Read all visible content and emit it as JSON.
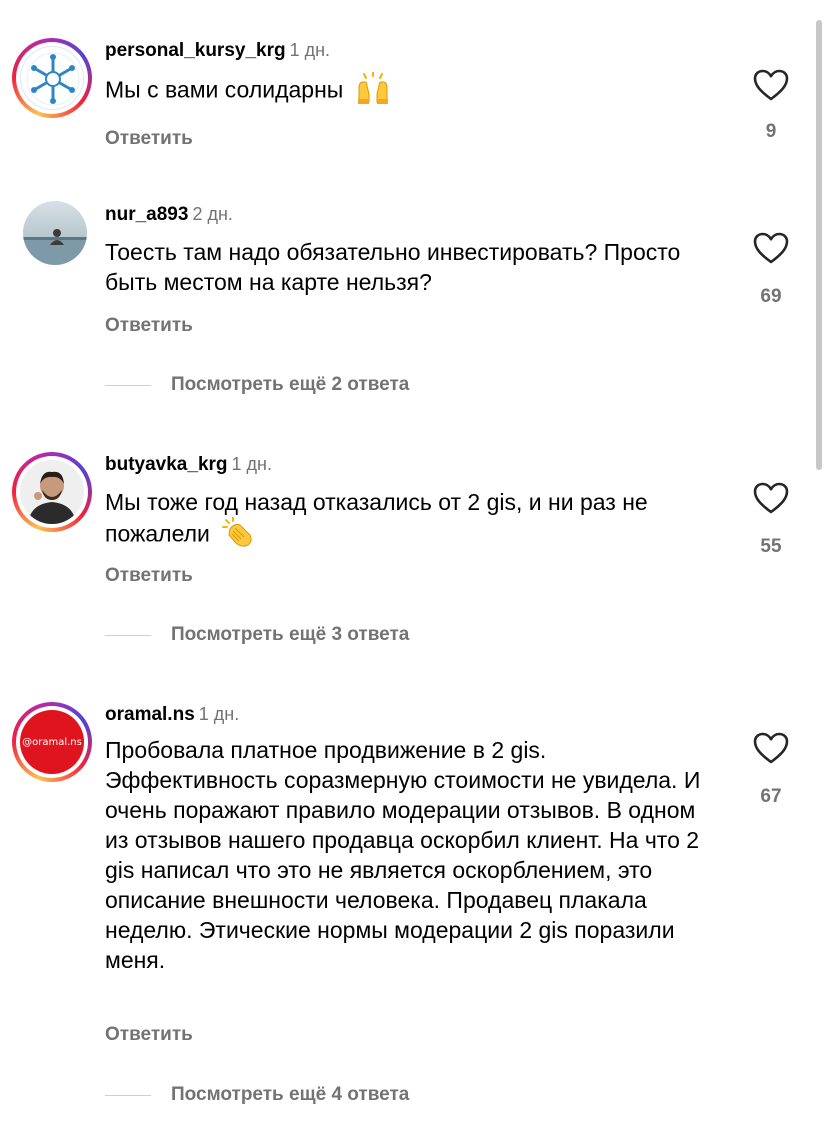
{
  "comments": [
    {
      "username": "personal_kursy_krg",
      "time": "1 дн.",
      "text": "Мы с вами солидарны",
      "emoji": "raising-hands",
      "reply_label": "Ответить",
      "likes": "9"
    },
    {
      "username": "nur_a893",
      "time": "2 дн.",
      "text": "Тоесть там надо обязательно инвестировать? Просто быть местом на карте нельзя?",
      "reply_label": "Ответить",
      "likes": "69",
      "view_more": "Посмотреть ещё 2 ответа"
    },
    {
      "username": "butyavka_krg",
      "time": "1 дн.",
      "text": "Мы тоже год назад отказались от 2 gis, и ни раз не пожалели",
      "emoji": "clapping-hands",
      "reply_label": "Ответить",
      "likes": "55",
      "view_more": "Посмотреть ещё 3 ответа"
    },
    {
      "username": "oramal.ns",
      "time": "1 дн.",
      "avatar_text": "@oramal.ns",
      "text": "Пробовала платное продвижение в 2 gis. Эффективность соразмерную стоимости не увидела. И очень поражают правило модерации отзывов. В одном из отзывов нашего продавца оскорбил клиент. На что 2 gis написал что это не является оскорблением, это описание внешности человека. Продавец плакала неделю. Этические нормы модерации 2 gis поразили меня.",
      "reply_label": "Ответить",
      "likes": "67",
      "view_more": "Посмотреть ещё 4 ответа"
    }
  ],
  "colors": {
    "secondary_text": "#737373",
    "story_ring": [
      "#fec053",
      "#f2203e",
      "#b729a8"
    ],
    "oramal_avatar_bg": "#e0141e"
  }
}
